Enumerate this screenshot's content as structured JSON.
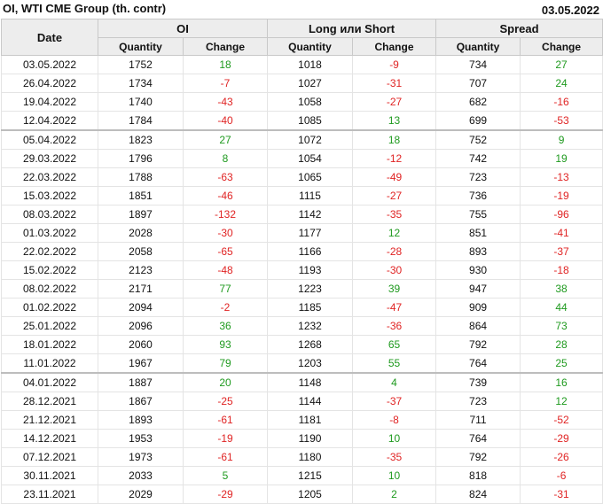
{
  "header": {
    "title": "OI, WTI CME Group (th. contr)",
    "date": "03.05.2022"
  },
  "columns": {
    "date": "Date",
    "oi": "OI",
    "long_short": "Long или Short",
    "spread": "Spread",
    "quantity": "Quantity",
    "change": "Change"
  },
  "colors": {
    "positive": "#1f9a1f",
    "negative": "#e02424",
    "header_bg": "#ededed"
  },
  "separator_after_rows": [
    3,
    16
  ],
  "rows": [
    {
      "date": "03.05.2022",
      "oi_q": "1752",
      "oi_c": "18",
      "ls_q": "1018",
      "ls_c": "-9",
      "sp_q": "734",
      "sp_c": "27"
    },
    {
      "date": "26.04.2022",
      "oi_q": "1734",
      "oi_c": "-7",
      "ls_q": "1027",
      "ls_c": "-31",
      "sp_q": "707",
      "sp_c": "24"
    },
    {
      "date": "19.04.2022",
      "oi_q": "1740",
      "oi_c": "-43",
      "ls_q": "1058",
      "ls_c": "-27",
      "sp_q": "682",
      "sp_c": "-16"
    },
    {
      "date": "12.04.2022",
      "oi_q": "1784",
      "oi_c": "-40",
      "ls_q": "1085",
      "ls_c": "13",
      "sp_q": "699",
      "sp_c": "-53"
    },
    {
      "date": "05.04.2022",
      "oi_q": "1823",
      "oi_c": "27",
      "ls_q": "1072",
      "ls_c": "18",
      "sp_q": "752",
      "sp_c": "9"
    },
    {
      "date": "29.03.2022",
      "oi_q": "1796",
      "oi_c": "8",
      "ls_q": "1054",
      "ls_c": "-12",
      "sp_q": "742",
      "sp_c": "19"
    },
    {
      "date": "22.03.2022",
      "oi_q": "1788",
      "oi_c": "-63",
      "ls_q": "1065",
      "ls_c": "-49",
      "sp_q": "723",
      "sp_c": "-13"
    },
    {
      "date": "15.03.2022",
      "oi_q": "1851",
      "oi_c": "-46",
      "ls_q": "1115",
      "ls_c": "-27",
      "sp_q": "736",
      "sp_c": "-19"
    },
    {
      "date": "08.03.2022",
      "oi_q": "1897",
      "oi_c": "-132",
      "ls_q": "1142",
      "ls_c": "-35",
      "sp_q": "755",
      "sp_c": "-96"
    },
    {
      "date": "01.03.2022",
      "oi_q": "2028",
      "oi_c": "-30",
      "ls_q": "1177",
      "ls_c": "12",
      "sp_q": "851",
      "sp_c": "-41"
    },
    {
      "date": "22.02.2022",
      "oi_q": "2058",
      "oi_c": "-65",
      "ls_q": "1166",
      "ls_c": "-28",
      "sp_q": "893",
      "sp_c": "-37"
    },
    {
      "date": "15.02.2022",
      "oi_q": "2123",
      "oi_c": "-48",
      "ls_q": "1193",
      "ls_c": "-30",
      "sp_q": "930",
      "sp_c": "-18"
    },
    {
      "date": "08.02.2022",
      "oi_q": "2171",
      "oi_c": "77",
      "ls_q": "1223",
      "ls_c": "39",
      "sp_q": "947",
      "sp_c": "38"
    },
    {
      "date": "01.02.2022",
      "oi_q": "2094",
      "oi_c": "-2",
      "ls_q": "1185",
      "ls_c": "-47",
      "sp_q": "909",
      "sp_c": "44"
    },
    {
      "date": "25.01.2022",
      "oi_q": "2096",
      "oi_c": "36",
      "ls_q": "1232",
      "ls_c": "-36",
      "sp_q": "864",
      "sp_c": "73"
    },
    {
      "date": "18.01.2022",
      "oi_q": "2060",
      "oi_c": "93",
      "ls_q": "1268",
      "ls_c": "65",
      "sp_q": "792",
      "sp_c": "28"
    },
    {
      "date": "11.01.2022",
      "oi_q": "1967",
      "oi_c": "79",
      "ls_q": "1203",
      "ls_c": "55",
      "sp_q": "764",
      "sp_c": "25"
    },
    {
      "date": "04.01.2022",
      "oi_q": "1887",
      "oi_c": "20",
      "ls_q": "1148",
      "ls_c": "4",
      "sp_q": "739",
      "sp_c": "16"
    },
    {
      "date": "28.12.2021",
      "oi_q": "1867",
      "oi_c": "-25",
      "ls_q": "1144",
      "ls_c": "-37",
      "sp_q": "723",
      "sp_c": "12"
    },
    {
      "date": "21.12.2021",
      "oi_q": "1893",
      "oi_c": "-61",
      "ls_q": "1181",
      "ls_c": "-8",
      "sp_q": "711",
      "sp_c": "-52"
    },
    {
      "date": "14.12.2021",
      "oi_q": "1953",
      "oi_c": "-19",
      "ls_q": "1190",
      "ls_c": "10",
      "sp_q": "764",
      "sp_c": "-29"
    },
    {
      "date": "07.12.2021",
      "oi_q": "1973",
      "oi_c": "-61",
      "ls_q": "1180",
      "ls_c": "-35",
      "sp_q": "792",
      "sp_c": "-26"
    },
    {
      "date": "30.11.2021",
      "oi_q": "2033",
      "oi_c": "5",
      "ls_q": "1215",
      "ls_c": "10",
      "sp_q": "818",
      "sp_c": "-6"
    },
    {
      "date": "23.11.2021",
      "oi_q": "2029",
      "oi_c": "-29",
      "ls_q": "1205",
      "ls_c": "2",
      "sp_q": "824",
      "sp_c": "-31"
    }
  ]
}
